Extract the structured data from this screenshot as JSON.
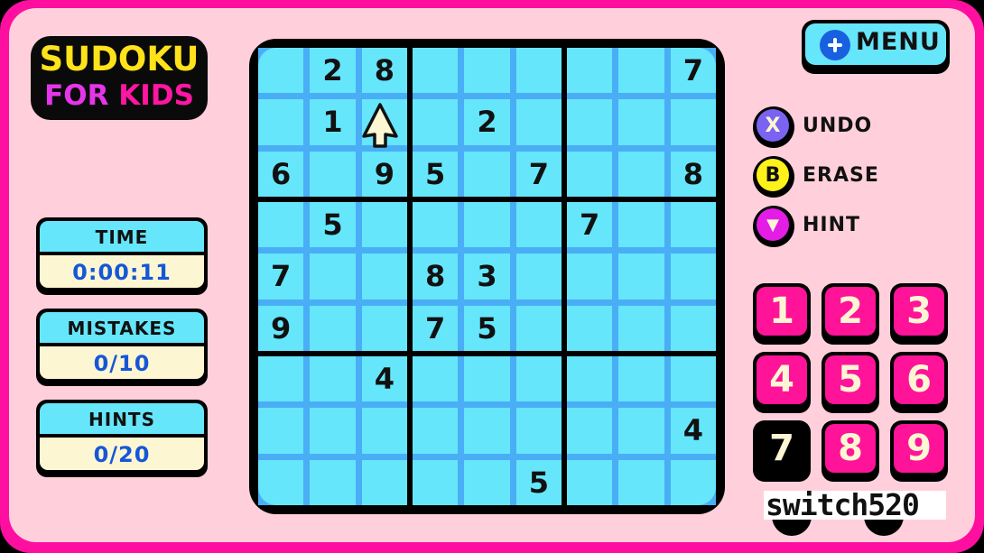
{
  "logo": {
    "line1": "SUDOKU",
    "line2_a": "FOR",
    "line2_b": "KIDS"
  },
  "stats": [
    {
      "label": "TIME",
      "value": "0:00:11"
    },
    {
      "label": "MISTAKES",
      "value": "0/10"
    },
    {
      "label": "HINTS",
      "value": "0/20"
    }
  ],
  "menu": {
    "label": "MENU",
    "icon": "plus-icon"
  },
  "actions": [
    {
      "key": "X",
      "label": "UNDO",
      "color": "#7a63f0",
      "icon": "x-button-icon"
    },
    {
      "key": "B",
      "label": "ERASE",
      "color": "#fff21a",
      "icon": "b-button-icon"
    },
    {
      "key": "▼",
      "label": "HINT",
      "color": "#e31de6",
      "icon": "down-button-icon"
    }
  ],
  "numpad": {
    "keys": [
      "1",
      "2",
      "3",
      "4",
      "5",
      "6",
      "7",
      "8",
      "9"
    ],
    "selected": "7"
  },
  "board": {
    "grid": [
      [
        "",
        "2",
        "8",
        "",
        "",
        "",
        "",
        "",
        "7"
      ],
      [
        "",
        "1",
        "",
        "",
        "2",
        "",
        "",
        "",
        ""
      ],
      [
        "6",
        "",
        "9",
        "5",
        "",
        "7",
        "",
        "",
        "8"
      ],
      [
        "",
        "5",
        "",
        "",
        "",
        "",
        "7",
        "",
        ""
      ],
      [
        "7",
        "",
        "",
        "8",
        "3",
        "",
        "",
        "",
        ""
      ],
      [
        "9",
        "",
        "",
        "7",
        "5",
        "",
        "",
        "",
        ""
      ],
      [
        "",
        "",
        "4",
        "",
        "",
        "",
        "",
        "",
        ""
      ],
      [
        "",
        "",
        "",
        "",
        "",
        "",
        "",
        "",
        "4"
      ],
      [
        "",
        "",
        "",
        "",
        "",
        "5",
        "",
        "",
        ""
      ]
    ],
    "cursor_cell": [
      1,
      2
    ]
  },
  "watermark": "switch520",
  "colors": {
    "frame": "#ff0fa0",
    "background": "#ffd0dc",
    "cell": "#66e6fb",
    "grid_line": "#4aaef6",
    "key": "#ff1399",
    "value_text": "#1557d6"
  }
}
